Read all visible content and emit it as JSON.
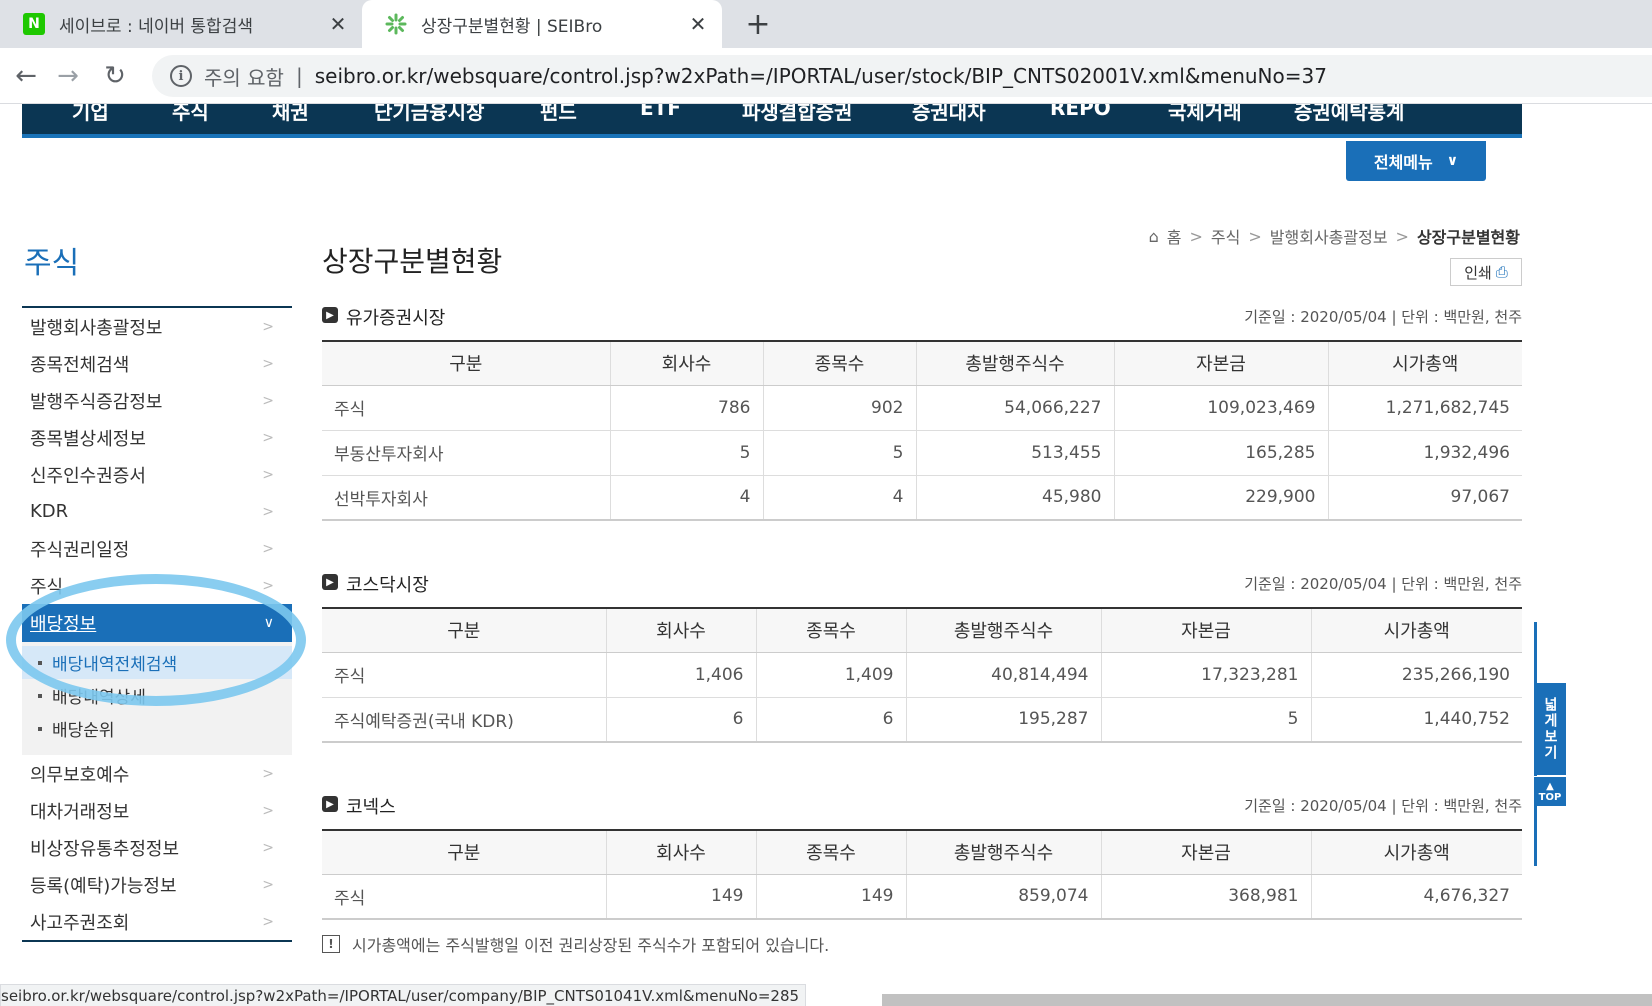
{
  "browser": {
    "tabs": [
      {
        "favicon": "naver-icon",
        "title": "세이브로 : 네이버 통합검색",
        "active": false
      },
      {
        "favicon": "seibro-icon",
        "title": "상장구분별현황 | SEIBro",
        "active": true
      }
    ],
    "new_tab_label": "+",
    "security_label": "주의 요함",
    "url": "seibro.or.kr/websquare/control.jsp?w2xPath=/IPORTAL/user/stock/BIP_CNTS02001V.xml&menuNo=37",
    "status_url": "seibro.or.kr/websquare/control.jsp?w2xPath=/IPORTAL/user/company/BIP_CNTS01041V.xml&menuNo=285"
  },
  "gnb": {
    "items": [
      "기업",
      "주식",
      "채권",
      "단기금융시장",
      "펀드",
      "ETF",
      "파생결합증권",
      "증권대차",
      "REPO",
      "국제거래",
      "증권예탁통계"
    ],
    "all_menu_label": "전체메뉴"
  },
  "lnb": {
    "title": "주식",
    "items_top": [
      "발행회사총괄정보",
      "종목전체검색",
      "발행주식증감정보",
      "종목별상세정보",
      "신주인수권증서",
      "KDR",
      "주식권리일정",
      "주식"
    ],
    "active_item": "배당정보",
    "sub_items": [
      "배당내역전체검색",
      "배당내역상세",
      "배당순위"
    ],
    "items_bottom": [
      "의무보호예수",
      "대차거래정보",
      "비상장유통추정정보",
      "등록(예탁)가능정보",
      "사고주권조회"
    ]
  },
  "page": {
    "title": "상장구분별현황",
    "breadcrumb": [
      "홈",
      "주식",
      "발행회사총괄정보",
      "상장구분별현황"
    ],
    "print_label": "인쇄"
  },
  "headers": [
    "구분",
    "회사수",
    "종목수",
    "총발행주식수",
    "자본금",
    "시가총액"
  ],
  "sections": {
    "kospi": {
      "title": "유가증권시장",
      "meta": "기준일 : 2020/05/04  |  단위 : 백만원, 천주",
      "rows": [
        [
          "주식",
          "786",
          "902",
          "54,066,227",
          "109,023,469",
          "1,271,682,745"
        ],
        [
          "부동산투자회사",
          "5",
          "5",
          "513,455",
          "165,285",
          "1,932,496"
        ],
        [
          "선박투자회사",
          "4",
          "4",
          "45,980",
          "229,900",
          "97,067"
        ]
      ]
    },
    "kosdaq": {
      "title": "코스닥시장",
      "meta": "기준일 : 2020/05/04  |  단위 : 백만원, 천주",
      "rows": [
        [
          "주식",
          "1,406",
          "1,409",
          "40,814,494",
          "17,323,281",
          "235,266,190"
        ],
        [
          "주식예탁증권(국내 KDR)",
          "6",
          "6",
          "195,287",
          "5",
          "1,440,752"
        ]
      ]
    },
    "konex": {
      "title": "코넥스",
      "meta": "기준일 : 2020/05/04  |  단위 : 백만원, 천주",
      "rows": [
        [
          "주식",
          "149",
          "149",
          "859,074",
          "368,981",
          "4,676,327"
        ]
      ]
    }
  },
  "note": "시가총액에는 주식발행일 이전 권리상장된 주식수가 포함되어 있습니다.",
  "side": {
    "wide_label": "넓게보기",
    "top_label": "TOP"
  }
}
